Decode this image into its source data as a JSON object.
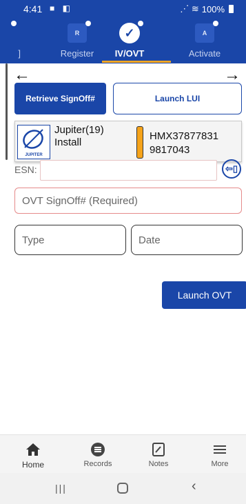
{
  "status_bar": {
    "time": "4:41",
    "battery": "100%"
  },
  "steps": {
    "left_partial_label": "]",
    "register": {
      "icon_letter": "R",
      "label": "Register"
    },
    "ivovt": {
      "label": "IV/OVT"
    },
    "activate": {
      "icon_letter": "A",
      "label": "Activate"
    }
  },
  "nav_arrows": {
    "back": "←",
    "forward": "→"
  },
  "actions": {
    "retrieve_label": "Retrieve SignOff#",
    "launch_lui_label": "Launch LUI"
  },
  "device": {
    "logo_text": "JUPITER",
    "name_line1": "Jupiter(19)",
    "name_line2": "Install",
    "serial_line1": "HMX37877831",
    "serial_line2": "9817043",
    "status_color": "#f5a31a"
  },
  "esn": {
    "label": "ESN:",
    "value": "",
    "scan_icon": "barcode-scan-icon"
  },
  "ovt_signoff": {
    "placeholder": "OVT SignOff# (Required)",
    "value": ""
  },
  "type_field": {
    "placeholder": "Type"
  },
  "date_field": {
    "placeholder": "Date"
  },
  "launch_ovt_label": "Launch OVT",
  "bottom_nav": {
    "home": "Home",
    "records": "Records",
    "notes": "Notes",
    "more": "More"
  },
  "colors": {
    "primary": "#1a46a8",
    "accent": "#f5a623",
    "error_border": "#e58a8a"
  }
}
